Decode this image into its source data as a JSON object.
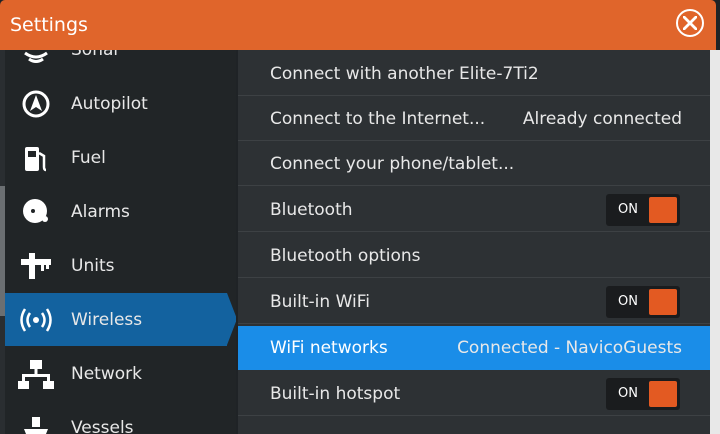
{
  "window": {
    "title": "Settings"
  },
  "sidebar": {
    "items": [
      {
        "label": "Sonar",
        "icon": "sonar-icon"
      },
      {
        "label": "Autopilot",
        "icon": "autopilot-icon"
      },
      {
        "label": "Fuel",
        "icon": "fuel-pump-icon"
      },
      {
        "label": "Alarms",
        "icon": "alarm-bell-icon"
      },
      {
        "label": "Units",
        "icon": "ruler-icon"
      },
      {
        "label": "Wireless",
        "icon": "wireless-icon",
        "selected": true
      },
      {
        "label": "Network",
        "icon": "network-icon"
      },
      {
        "label": "Vessels",
        "icon": "vessels-icon"
      }
    ]
  },
  "panel": {
    "rows": [
      {
        "label": "Connect with another Elite-7Ti2"
      },
      {
        "label": "Connect to the Internet...",
        "value": "Already connected"
      },
      {
        "label": "Connect your phone/tablet..."
      },
      {
        "label": "Bluetooth",
        "toggle": "ON"
      },
      {
        "label": "Bluetooth options"
      },
      {
        "label": "Built-in WiFi",
        "toggle": "ON"
      },
      {
        "label": "WiFi networks",
        "value": "Connected - NavicoGuests",
        "selected": true
      },
      {
        "label": "Built-in hotspot",
        "toggle": "ON"
      }
    ]
  },
  "colors": {
    "accent": "#e0652b",
    "selection": "#1a8de8",
    "sidebar_selection": "#13629f",
    "toggle_on": "#e35a22"
  }
}
